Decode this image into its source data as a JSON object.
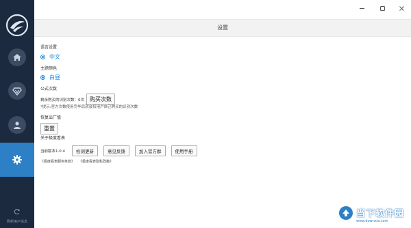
{
  "window": {
    "title": "设置",
    "controls": [
      "minimize",
      "maximize",
      "close"
    ]
  },
  "sidebar": {
    "items": [
      {
        "name": "home",
        "icon": "home-icon",
        "active": false
      },
      {
        "name": "vip",
        "icon": "diamond-icon",
        "active": false
      },
      {
        "name": "user",
        "icon": "user-icon",
        "active": false
      },
      {
        "name": "settings",
        "icon": "gear-icon",
        "active": true
      }
    ],
    "refresh_label": "刷新用户信息"
  },
  "settings": {
    "language": {
      "title": "语言设置",
      "option": "中文"
    },
    "theme": {
      "title": "主题颜色",
      "option": "白昼"
    },
    "formula": {
      "title": "公式次数",
      "remaining_label": "剩余购买的识别次数：0次",
      "buy_button": "购买次数",
      "hint": "*提示:官方次数使用完毕后就会扣用户自己购买的识别次数"
    },
    "factory_reset": {
      "title": "恢复出厂值",
      "reset_button": "重置"
    },
    "about": {
      "title": "关于极度看表",
      "version": "当前版本1.0.4",
      "buttons": [
        "检测更新",
        "意见反馈",
        "加入官方群",
        "使用手册"
      ],
      "links": [
        "《极度看表服务条款》",
        "《极度看表隐私政策》"
      ]
    }
  },
  "watermark": {
    "main": "当下软件园",
    "sub": "www.downxia.com"
  },
  "colors": {
    "sidebar_bg": "#1b2a3e",
    "accent": "#2d7fc6",
    "radio": "#1e88e5"
  }
}
